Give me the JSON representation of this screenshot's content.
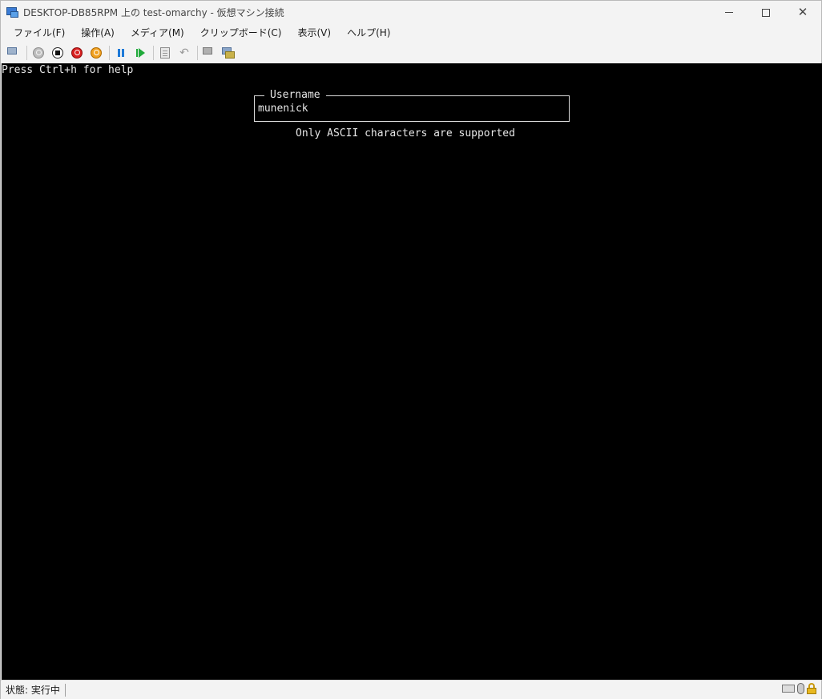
{
  "window": {
    "title": "DESKTOP-DB85RPM 上の test-omarchy - 仮想マシン接続"
  },
  "menu": {
    "items": [
      {
        "label": "ファイル(F)"
      },
      {
        "label": "操作(A)"
      },
      {
        "label": "メディア(M)"
      },
      {
        "label": "クリップボード(C)"
      },
      {
        "label": "表示(V)"
      },
      {
        "label": "ヘルプ(H)"
      }
    ]
  },
  "toolbar": {
    "icons": [
      "ctrl-alt-del-icon",
      "start-icon",
      "turn-off-icon",
      "shut-down-icon",
      "save-icon",
      "pause-icon",
      "reset-icon",
      "checkpoint-icon",
      "revert-icon",
      "enhanced-session-icon",
      "share-icon"
    ]
  },
  "console": {
    "help_line": "Press Ctrl+h for help",
    "field_legend": "Username",
    "field_value": "munenick",
    "hint": "Only ASCII characters are supported"
  },
  "status": {
    "text": "状態: 実行中"
  },
  "colors": {
    "console_bg": "#000000",
    "console_fg": "#e6e6e6",
    "chrome_bg": "#f3f3f3"
  }
}
